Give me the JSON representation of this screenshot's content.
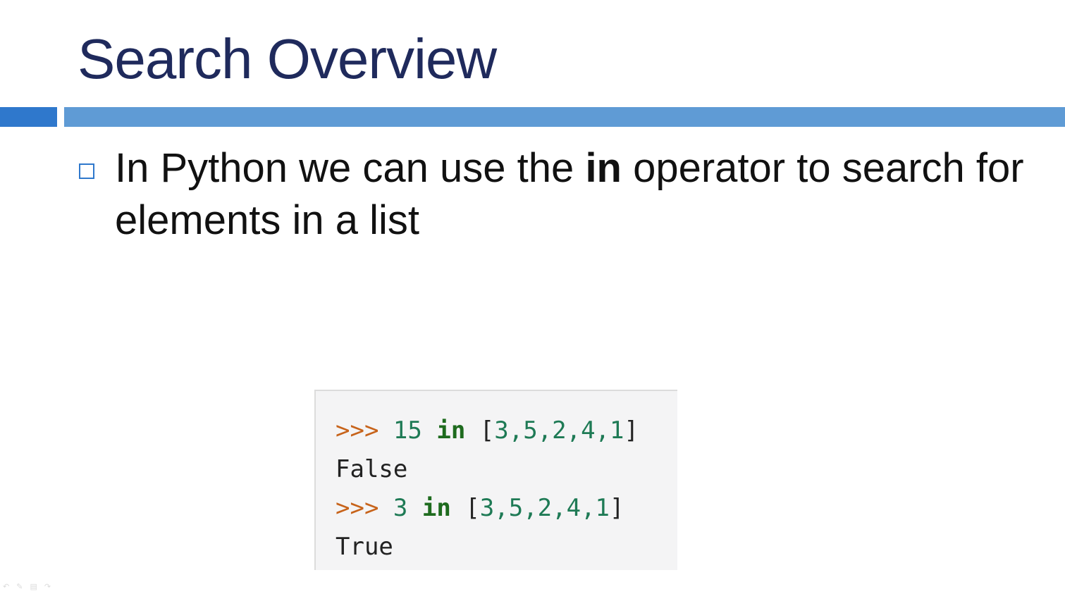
{
  "slide": {
    "title": "Search Overview",
    "bullet": {
      "text_before": "In Python we can use the ",
      "bold": "in",
      "text_after": " operator to search for elements in a list"
    },
    "code": {
      "line1": {
        "prompt": ">>>",
        "num": "15",
        "kw": "in",
        "open": "[",
        "items": "3,5,2,4,1",
        "close": "]"
      },
      "line2": {
        "output": "False"
      },
      "line3": {
        "prompt": ">>>",
        "num": "3",
        "kw": "in",
        "open": "[",
        "items": "3,5,2,4,1",
        "close": "]"
      },
      "line4": {
        "output": "True"
      }
    }
  },
  "colors": {
    "title": "#1f2a5c",
    "accent_bar_left": "#2f78cc",
    "accent_bar_right": "#5f9bd5",
    "prompt": "#c7631a",
    "number": "#1e7a55",
    "keyword": "#1e6b1e"
  },
  "nav_icons": [
    "back-arrow-icon",
    "pen-icon",
    "menu-icon",
    "forward-arrow-icon"
  ]
}
